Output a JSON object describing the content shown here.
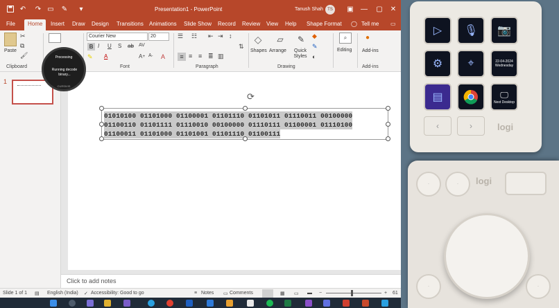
{
  "titlebar": {
    "title": "Presentation1 - PowerPoint",
    "user": "Tanush Shah",
    "initials": "TS"
  },
  "tabs": [
    "File",
    "Home",
    "Insert",
    "Draw",
    "Design",
    "Transitions",
    "Animations",
    "Slide Show",
    "Record",
    "Review",
    "View",
    "Help",
    "Shape Format"
  ],
  "tellme": "Tell me",
  "ribbon": {
    "paste": "Paste",
    "clipboard": "Clipboard",
    "font_name": "Courier New",
    "font_size": "20",
    "font": "Font",
    "paragraph": "Paragraph",
    "shapes": "Shapes",
    "arrange": "Arrange",
    "quick_styles": "Quick Styles",
    "drawing": "Drawing",
    "editing": "Editing",
    "addins": "Add-ins",
    "addins_group": "Add-ins"
  },
  "overlay": {
    "status": "Processing",
    "message": "Running decode binary...",
    "brand": "CURSIVIS"
  },
  "slide_panel": {
    "number": "1"
  },
  "textbox": {
    "lines": [
      "01010100 01101000 01100001 01101110 01101011 01110011 00100000",
      "01100110 01101111 01110010 00100000 01110111 01100001 01110100",
      "01100011 01101000 01101001 01101110 01100111"
    ]
  },
  "notes": "Click to add notes",
  "status": {
    "slide": "Slide 1 of 1",
    "language": "English (India)",
    "accessibility": "Accessibility: Good to go",
    "notes": "Notes",
    "comments": "Comments",
    "zoom": "61"
  },
  "deck": {
    "keys": [
      "play",
      "mic",
      "camera",
      "gear",
      "cursor",
      "date",
      "stack",
      "chrome",
      "desktop"
    ],
    "date_line1": "22-04-2024",
    "date_line2": "Wednesday",
    "desktop_label": "Next Desktop",
    "logo": "logi"
  },
  "dial": {
    "logo": "logi"
  }
}
